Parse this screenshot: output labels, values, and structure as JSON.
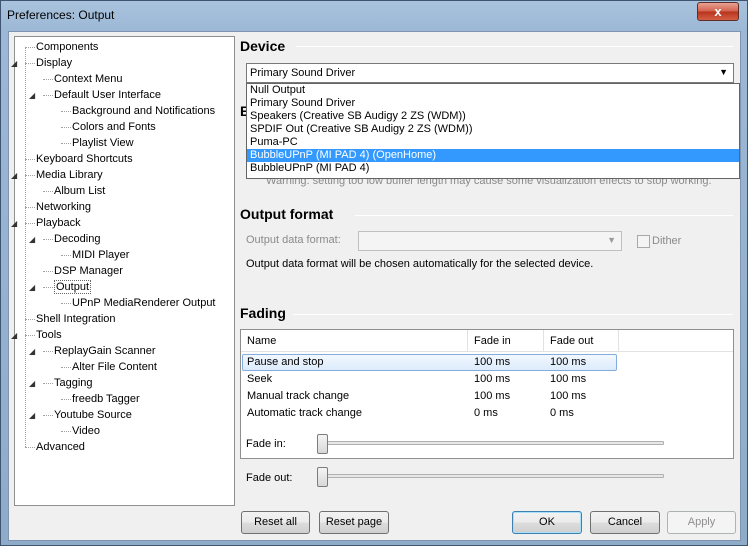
{
  "window": {
    "title": "Preferences: Output",
    "close_glyph": "x"
  },
  "tree": {
    "items": [
      {
        "label": "Components",
        "expander": ""
      },
      {
        "label": "Display",
        "expander": "◢"
      },
      {
        "label": "Context Menu",
        "expander": ""
      },
      {
        "label": "Default User Interface",
        "expander": "◢"
      },
      {
        "label": "Background and Notifications",
        "expander": ""
      },
      {
        "label": "Colors and Fonts",
        "expander": ""
      },
      {
        "label": "Playlist View",
        "expander": ""
      },
      {
        "label": "Keyboard Shortcuts",
        "expander": ""
      },
      {
        "label": "Media Library",
        "expander": "◢"
      },
      {
        "label": "Album List",
        "expander": ""
      },
      {
        "label": "Networking",
        "expander": ""
      },
      {
        "label": "Playback",
        "expander": "◢"
      },
      {
        "label": "Decoding",
        "expander": "◢"
      },
      {
        "label": "MIDI Player",
        "expander": ""
      },
      {
        "label": "DSP Manager",
        "expander": ""
      },
      {
        "label": "Output",
        "expander": "◢"
      },
      {
        "label": "UPnP MediaRenderer Output",
        "expander": ""
      },
      {
        "label": "Shell Integration",
        "expander": ""
      },
      {
        "label": "Tools",
        "expander": "◢"
      },
      {
        "label": "ReplayGain Scanner",
        "expander": "◢"
      },
      {
        "label": "Alter File Content",
        "expander": ""
      },
      {
        "label": "Tagging",
        "expander": "◢"
      },
      {
        "label": "freedb Tagger",
        "expander": ""
      },
      {
        "label": "Youtube Source",
        "expander": "◢"
      },
      {
        "label": "Video",
        "expander": ""
      },
      {
        "label": "Advanced",
        "expander": ""
      }
    ],
    "selected": "Output"
  },
  "device": {
    "heading": "Device",
    "selected": "Primary Sound Driver",
    "dropdown_arrow": "▼",
    "options": [
      "Null Output",
      "Primary Sound Driver",
      "Speakers (Creative SB Audigy 2 ZS (WDM))",
      "SPDIF Out (Creative SB Audigy 2 ZS (WDM))",
      "Puma-PC",
      "BubbleUPnP (MI PAD 4) (OpenHome)",
      "BubbleUPnP (MI PAD 4)"
    ],
    "highlighted_option": "BubbleUPnP (MI PAD 4) (OpenHome)",
    "hidden_heading_fragment": "B",
    "warning": "Warning: setting too low buffer length may cause some visualization effects to stop working."
  },
  "output_format": {
    "heading": "Output format",
    "data_format_label": "Output data format:",
    "data_format_value": "",
    "dither_label": "Dither",
    "dither_checked": false,
    "info": "Output data format will be chosen automatically for the selected device."
  },
  "fading": {
    "heading": "Fading",
    "columns": [
      "Name",
      "Fade in",
      "Fade out"
    ],
    "rows": [
      {
        "name": "Pause and stop",
        "fade_in": "100 ms",
        "fade_out": "100 ms"
      },
      {
        "name": "Seek",
        "fade_in": "100 ms",
        "fade_out": "100 ms"
      },
      {
        "name": "Manual track change",
        "fade_in": "100 ms",
        "fade_out": "100 ms"
      },
      {
        "name": "Automatic track change",
        "fade_in": "0 ms",
        "fade_out": "0 ms"
      }
    ],
    "selected_row": "Pause and stop",
    "fade_in_label": "Fade in:",
    "fade_out_label": "Fade out:",
    "fade_in_level": 0,
    "fade_out_level": 0
  },
  "buttons": {
    "reset_all": "Reset all",
    "reset_page": "Reset page",
    "ok": "OK",
    "cancel": "Cancel",
    "apply": "Apply"
  },
  "colors": {
    "highlight": "#3399ff",
    "selection_row": "#dcebfc",
    "window_frame": "#9cb8d6"
  }
}
